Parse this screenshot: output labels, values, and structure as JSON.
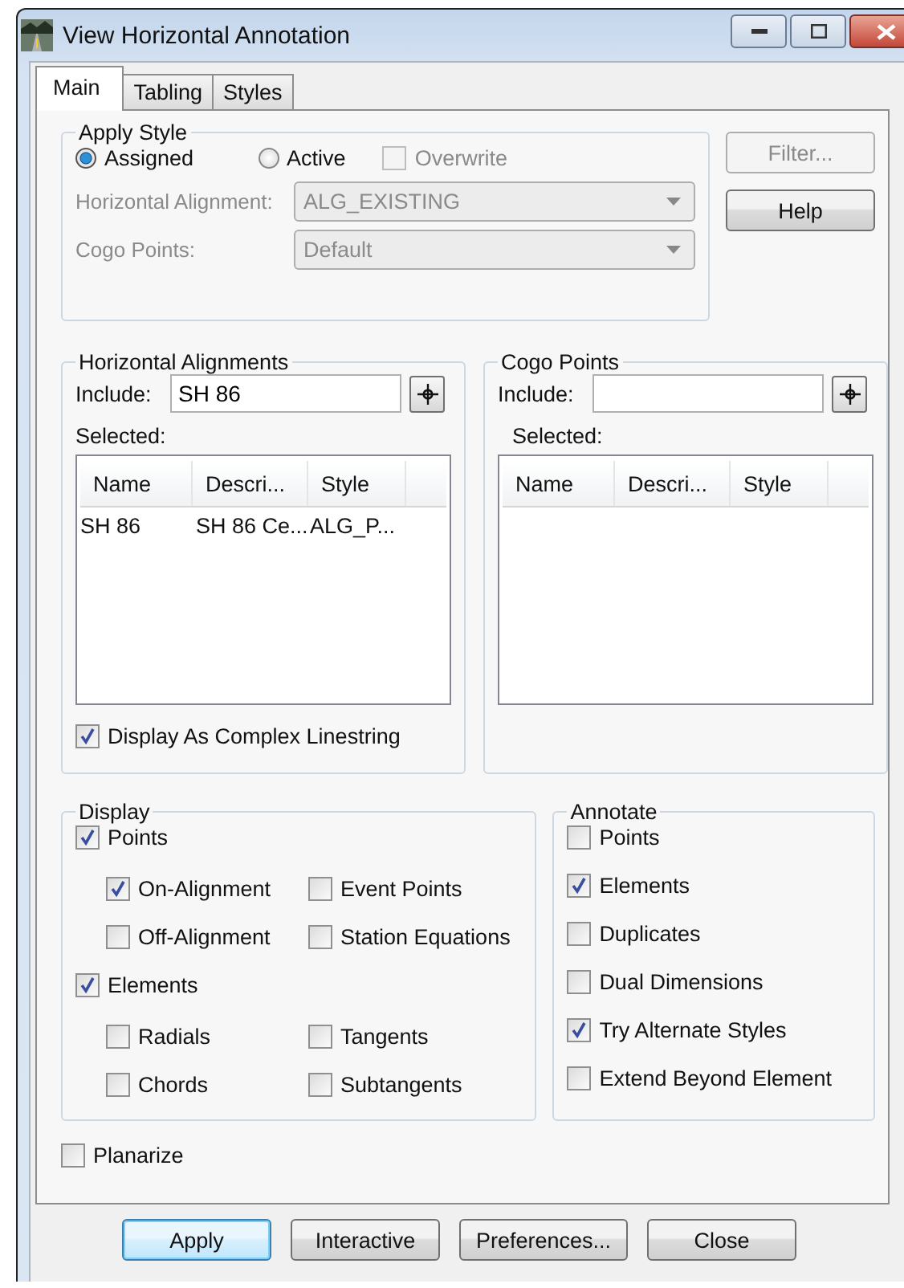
{
  "window": {
    "title": "View Horizontal Annotation"
  },
  "tabs": [
    {
      "label": "Main",
      "selected": true
    },
    {
      "label": "Tabling",
      "selected": false
    },
    {
      "label": "Styles",
      "selected": false
    }
  ],
  "apply_style": {
    "title": "Apply Style",
    "options": [
      {
        "label": "Assigned",
        "selected": true
      },
      {
        "label": "Active",
        "selected": false
      }
    ],
    "overwrite": {
      "label": "Overwrite",
      "checked": false,
      "disabled": true
    },
    "fields": [
      {
        "label": "Horizontal Alignment:",
        "value": "ALG_EXISTING",
        "disabled": true
      },
      {
        "label": "Cogo Points:",
        "value": "Default",
        "disabled": true
      }
    ]
  },
  "side_buttons": [
    {
      "label": "Filter...",
      "disabled": true
    },
    {
      "label": "Help",
      "disabled": false
    }
  ],
  "selection_groups": [
    {
      "title": "Horizontal Alignments",
      "include_label": "Include:",
      "include_value": "SH 86",
      "selected_label": "Selected:",
      "columns": [
        "Name",
        "Descri...",
        "Style"
      ],
      "rows": [
        [
          "SH 86",
          "SH 86 Ce...",
          "ALG_P..."
        ]
      ],
      "option": {
        "label": "Display As Complex Linestring",
        "checked": true
      }
    },
    {
      "title": "Cogo Points",
      "include_label": "Include:",
      "selected_label": "Selected:",
      "columns": [
        "Name",
        "Descri...",
        "Style"
      ]
    }
  ],
  "display": {
    "title": "Display",
    "items": [
      {
        "label": "Points",
        "checked": true,
        "children": [
          {
            "label": "On-Alignment",
            "checked": true
          },
          {
            "label": "Event Points",
            "checked": false
          },
          {
            "label": "Off-Alignment",
            "checked": false
          },
          {
            "label": "Station Equations",
            "checked": false
          }
        ]
      },
      {
        "label": "Elements",
        "checked": true,
        "children": [
          {
            "label": "Radials",
            "checked": false
          },
          {
            "label": "Tangents",
            "checked": false
          },
          {
            "label": "Chords",
            "checked": false
          },
          {
            "label": "Subtangents",
            "checked": false
          }
        ]
      }
    ]
  },
  "annotate": {
    "title": "Annotate",
    "items": [
      {
        "label": "Points",
        "checked": false
      },
      {
        "label": "Elements",
        "checked": true
      },
      {
        "label": "Duplicates",
        "checked": false
      },
      {
        "label": "Dual Dimensions",
        "checked": false
      },
      {
        "label": "Try Alternate Styles",
        "checked": true
      },
      {
        "label": "Extend Beyond Element",
        "checked": false
      }
    ]
  },
  "planarize": {
    "label": "Planarize",
    "checked": false
  },
  "buttons": [
    {
      "label": "Apply",
      "default": true
    },
    {
      "label": "Interactive",
      "default": false
    },
    {
      "label": "Preferences...",
      "default": false
    },
    {
      "label": "Close",
      "default": false
    }
  ]
}
